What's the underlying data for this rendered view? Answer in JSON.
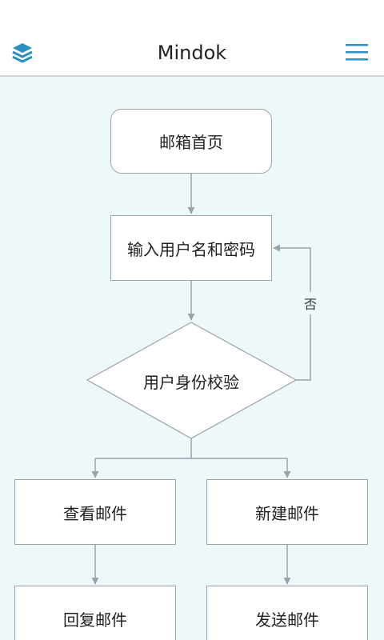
{
  "header": {
    "title": "Mindok",
    "logo_icon": "layers-icon",
    "menu_icon": "hamburger-menu-icon",
    "accent_color": "#2a8fc1"
  },
  "flowchart": {
    "nodes": {
      "mailbox_home": "邮箱首页",
      "enter_credentials": "输入用户名和密码",
      "verify_identity": "用户身份校验",
      "view_mail": "查看邮件",
      "new_mail": "新建邮件",
      "reply_mail": "回复邮件",
      "send_mail": "发送邮件"
    },
    "edge_labels": {
      "no": "否"
    },
    "colors": {
      "background": "#eef8fb",
      "node_fill": "#ffffff",
      "stroke": "#9aa3aa"
    }
  }
}
